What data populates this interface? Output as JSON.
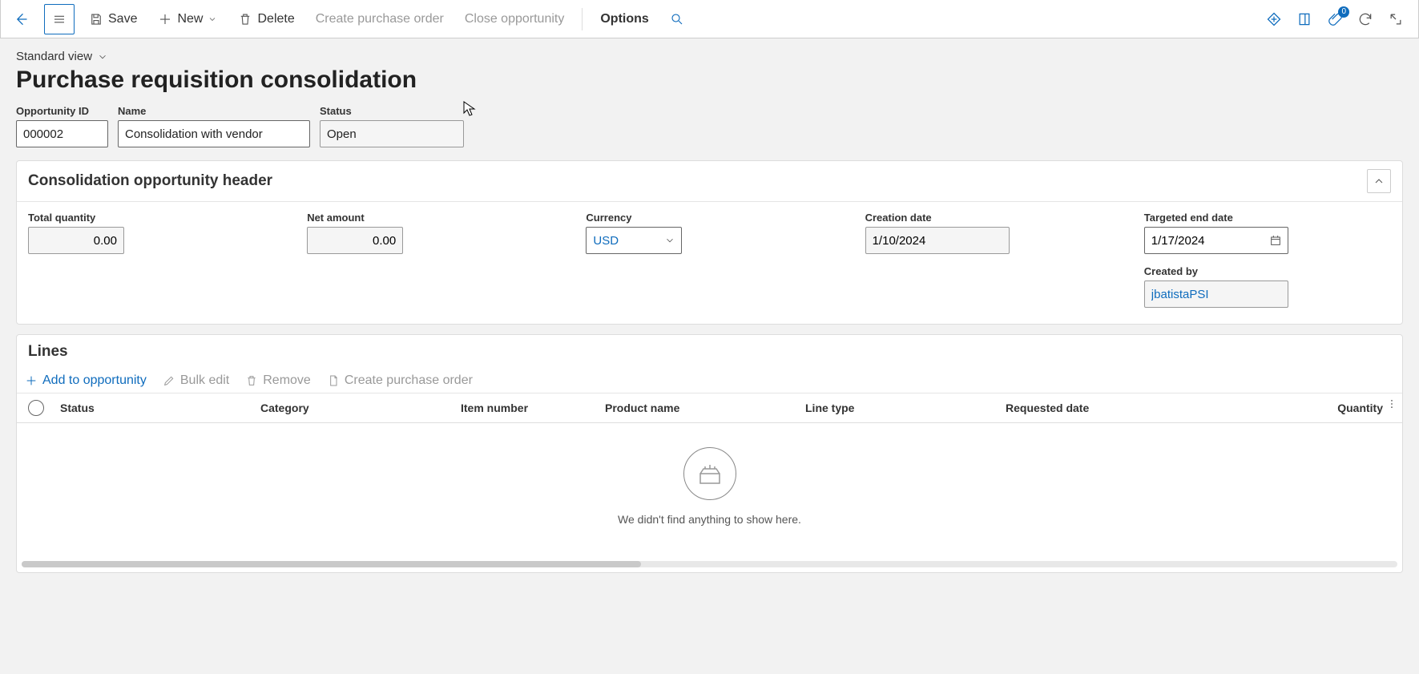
{
  "toolbar": {
    "save": "Save",
    "new": "New",
    "delete": "Delete",
    "create_po": "Create purchase order",
    "close_opp": "Close opportunity",
    "options": "Options",
    "notif_badge": "0"
  },
  "header": {
    "view_name": "Standard view",
    "page_title": "Purchase requisition consolidation",
    "fields": {
      "opportunity_id": {
        "label": "Opportunity ID",
        "value": "000002"
      },
      "name": {
        "label": "Name",
        "value": "Consolidation with vendor"
      },
      "status": {
        "label": "Status",
        "value": "Open"
      }
    }
  },
  "consolidation_header": {
    "title": "Consolidation opportunity header",
    "total_qty": {
      "label": "Total quantity",
      "value": "0.00"
    },
    "net_amount": {
      "label": "Net amount",
      "value": "0.00"
    },
    "currency": {
      "label": "Currency",
      "value": "USD"
    },
    "creation": {
      "label": "Creation date",
      "value": "1/10/2024"
    },
    "target_end": {
      "label": "Targeted end date",
      "value": "1/17/2024"
    },
    "created_by": {
      "label": "Created by",
      "value": "jbatistaPSI"
    }
  },
  "lines": {
    "title": "Lines",
    "toolbar": {
      "add": "Add to opportunity",
      "bulk": "Bulk edit",
      "remove": "Remove",
      "create": "Create purchase order"
    },
    "columns": {
      "status": "Status",
      "category": "Category",
      "item_no": "Item number",
      "product": "Product name",
      "line_type": "Line type",
      "req_date": "Requested date",
      "qty": "Quantity"
    },
    "empty_msg": "We didn't find anything to show here."
  }
}
